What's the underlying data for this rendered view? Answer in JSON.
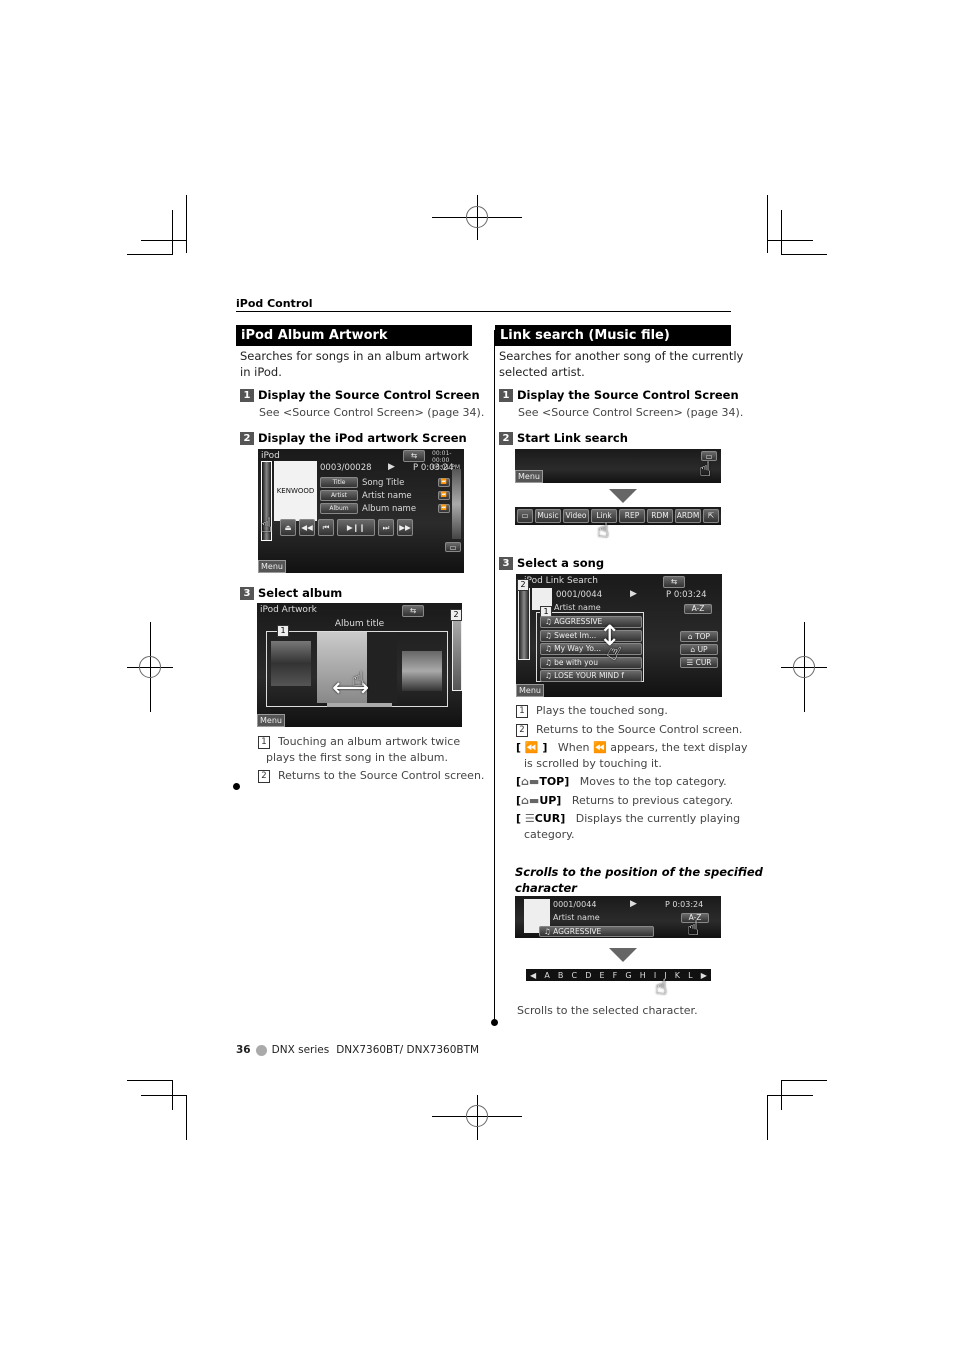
{
  "header": {
    "section": "iPod Control"
  },
  "left": {
    "title": "iPod Album Artwork",
    "intro": [
      "Searches for songs in an album artwork",
      "in iPod."
    ],
    "steps": [
      {
        "num": "1",
        "title": "Display the Source Control Screen",
        "sub": "See <Source Control Screen> (page 34)."
      },
      {
        "num": "2",
        "title": "Display the iPod artwork Screen"
      },
      {
        "num": "3",
        "title": "Select album"
      }
    ],
    "screen1": {
      "title": "iPod",
      "logo": "KENWOOD",
      "track": "0003/00028",
      "play_icon": "▶",
      "time": "P  0:03:24",
      "clock": [
        "00:01-00:00",
        "00:01 PM"
      ],
      "rows": [
        {
          "label": "Title",
          "value": "Song Title"
        },
        {
          "label": "Artist",
          "value": "Artist name"
        },
        {
          "label": "Album",
          "value": "Album name"
        }
      ],
      "controls": [
        "⏏",
        "◀◀",
        "⏮",
        "▶❙❙",
        "⏭",
        "▶▶"
      ],
      "menu": "Menu"
    },
    "screen2": {
      "title": "iPod Artwork",
      "album_title": "Album title",
      "callouts": [
        "1",
        "2"
      ],
      "menu": "Menu"
    },
    "notes": [
      {
        "num": "1",
        "text": "Touching an album artwork twice",
        "cont": "plays the first song in the album."
      },
      {
        "num": "2",
        "text": "Returns to the Source Control screen."
      }
    ]
  },
  "right": {
    "title": "Link search (Music file)",
    "intro": [
      "Searches for another song of the currently",
      "selected artist."
    ],
    "steps": [
      {
        "num": "1",
        "title": "Display the Source Control Screen",
        "sub": "See <Source Control Screen> (page 34)."
      },
      {
        "num": "2",
        "title": "Start Link search"
      },
      {
        "num": "3",
        "title": "Select a song"
      }
    ],
    "linkbar": {
      "menu": "Menu",
      "buttons": [
        "Music",
        "Video",
        "Link",
        "REP",
        "RDM",
        "ARDM"
      ]
    },
    "screen3": {
      "title": "iPod Link Search",
      "track": "0001/0044",
      "time": "P  0:03:24",
      "artist": "Artist name",
      "az": "A-Z",
      "songs": [
        "AGGRESSIVE",
        "Sweet Im...",
        "My Way Yo...",
        "be with you",
        "LOSE YOUR MIND f"
      ],
      "side_buttons": [
        "TOP",
        "UP",
        "CUR"
      ],
      "callouts": [
        "1",
        "2"
      ],
      "menu": "Menu"
    },
    "notes": [
      {
        "num": "1",
        "text": "Plays the touched song."
      },
      {
        "num": "2",
        "text": "Returns to the Source Control screen."
      }
    ],
    "legend": [
      {
        "key": "[ ⏪ ]",
        "text": "When ⏪ appears, the text display",
        "cont": "is scrolled by touching it."
      },
      {
        "key": "TOP]",
        "text": "Moves to the top category."
      },
      {
        "key": "UP]",
        "text": "Returns to previous category."
      },
      {
        "key": "CUR]",
        "text": "Displays the currently playing",
        "cont": "category."
      }
    ],
    "scroll_heading": [
      "Scrolls to the position of the specified",
      "character"
    ],
    "screen4": {
      "track": "0001/0044",
      "time": "P  0:03:24",
      "artist": "Artist name",
      "az": "A-Z",
      "song": "AGGRESSIVE"
    },
    "alphabar": [
      "◀",
      "A",
      "B",
      "C",
      "D",
      "E",
      "F",
      "G",
      "H",
      "I",
      "J",
      "K",
      "L",
      "▶"
    ],
    "scroll_note": "Scrolls to the selected character."
  },
  "footer": {
    "page": "36",
    "series": "DNX series",
    "models": "DNX7360BT/ DNX7360BTM"
  }
}
